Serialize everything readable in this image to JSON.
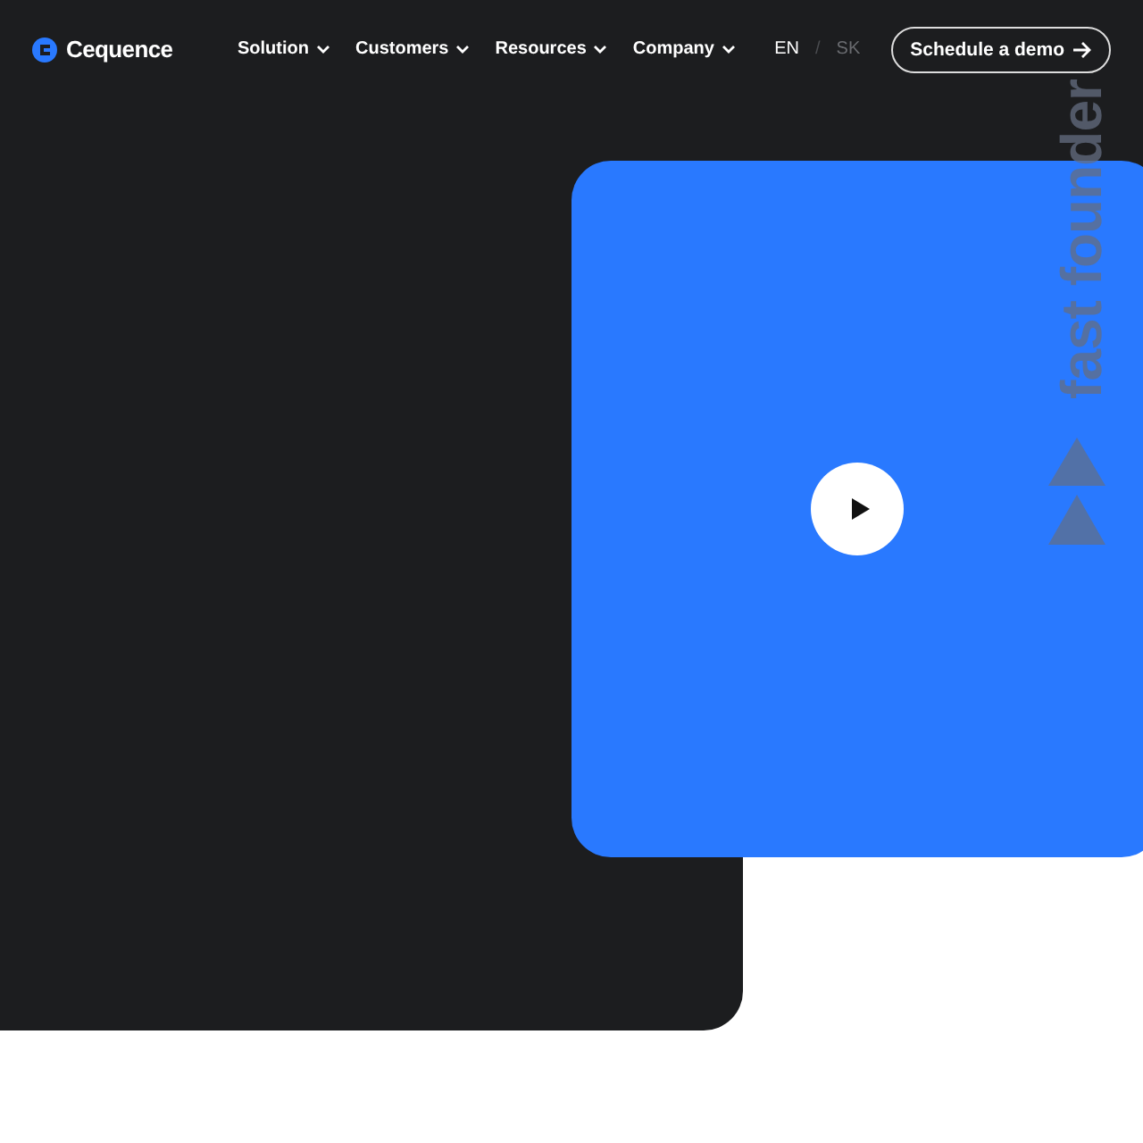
{
  "header": {
    "brand": "Cequence",
    "nav": [
      {
        "label": "Solution"
      },
      {
        "label": "Customers"
      },
      {
        "label": "Resources"
      },
      {
        "label": "Company"
      }
    ],
    "languages": [
      {
        "label": "EN",
        "selected": true
      },
      {
        "label": "SK",
        "selected": false
      }
    ],
    "separator": "/",
    "cta": "Schedule a demo"
  },
  "video": {
    "kind": "video",
    "caption": "fast founder"
  }
}
